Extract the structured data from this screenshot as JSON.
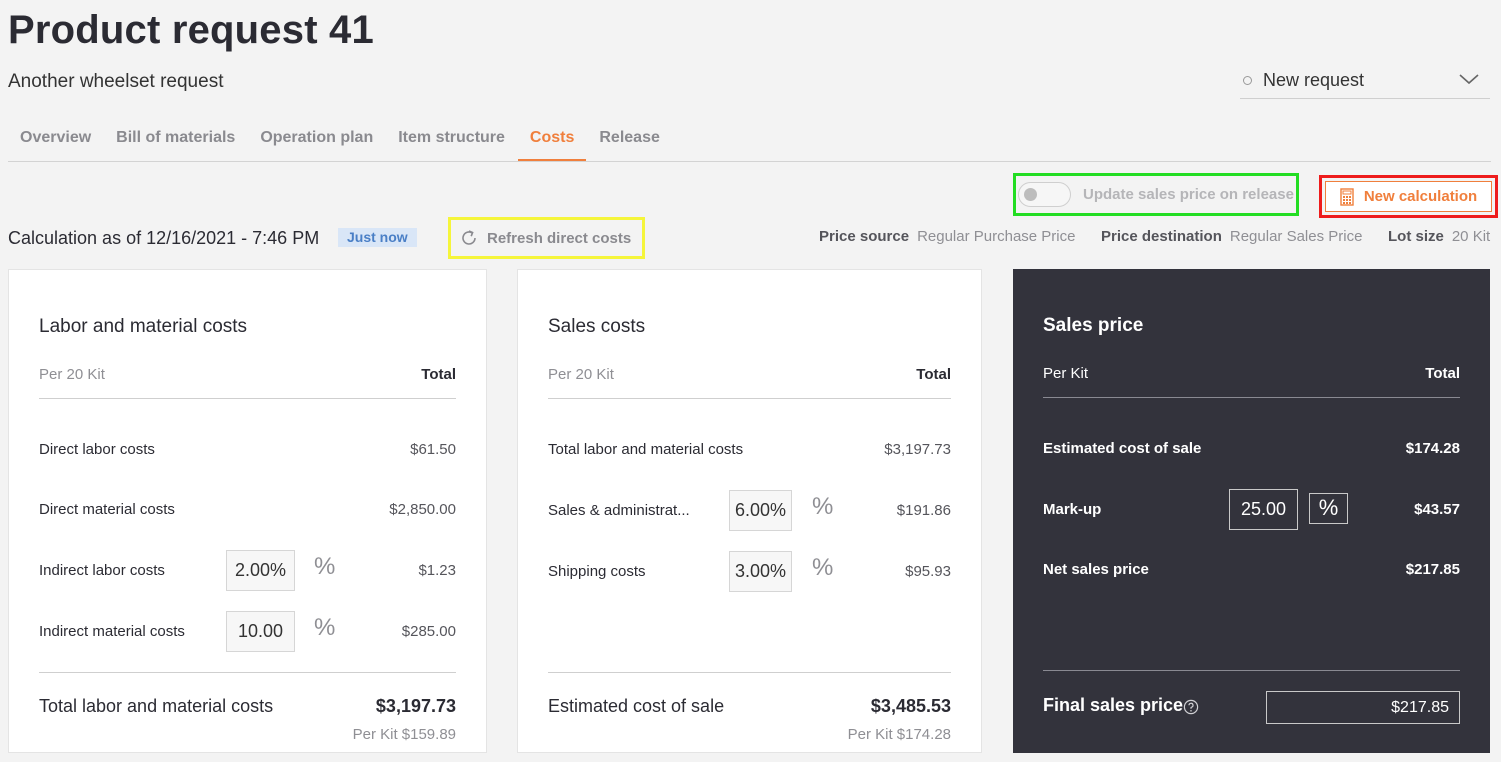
{
  "header": {
    "title": "Product request 41",
    "subtitle": "Another wheelset request",
    "status": "New request"
  },
  "tabs": [
    "Overview",
    "Bill of materials",
    "Operation plan",
    "Item structure",
    "Costs",
    "Release"
  ],
  "active_tab": "Costs",
  "toolbar": {
    "toggle_label": "Update sales price on release",
    "toggle_on": false,
    "new_calc_label": "New calculation",
    "calc_title": "Calculation as of 12/16/2021 - 7:46 PM",
    "badge": "Just now",
    "refresh_label": "Refresh direct costs"
  },
  "meta": {
    "price_source_label": "Price source",
    "price_source": "Regular Purchase Price",
    "price_dest_label": "Price destination",
    "price_dest": "Regular Sales Price",
    "lot_size_label": "Lot size",
    "lot_size": "20 Kit"
  },
  "labor": {
    "title": "Labor and material costs",
    "per": "Per 20 Kit",
    "total": "Total",
    "rows": [
      {
        "label": "Direct labor costs",
        "value": "$61.50"
      },
      {
        "label": "Direct material costs",
        "value": "$2,850.00"
      },
      {
        "label": "Indirect labor costs",
        "input": "2.00%",
        "value": "$1.23"
      },
      {
        "label": "Indirect material costs",
        "input": "10.00",
        "value": "$285.00"
      }
    ],
    "total_label": "Total labor and material costs",
    "total_value": "$3,197.73",
    "per_kit": "Per Kit $159.89"
  },
  "sales_costs": {
    "title": "Sales costs",
    "per": "Per 20 Kit",
    "total": "Total",
    "rows": [
      {
        "label": "Total labor and material costs",
        "value": "$3,197.73"
      },
      {
        "label": "Sales & administrat...",
        "input": "6.00%",
        "value": "$191.86"
      },
      {
        "label": "Shipping costs",
        "input": "3.00%",
        "value": "$95.93"
      }
    ],
    "total_label": "Estimated cost of sale",
    "total_value": "$3,485.53",
    "per_kit": "Per Kit $174.28"
  },
  "sales_price": {
    "title": "Sales price",
    "per": "Per Kit",
    "total": "Total",
    "rows": [
      {
        "label": "Estimated cost of sale",
        "value": "$174.28"
      },
      {
        "label": "Mark-up",
        "input": "25.00",
        "value": "$43.57"
      },
      {
        "label": "Net sales price",
        "value": "$217.85"
      }
    ],
    "final_label": "Final sales price",
    "final_value": "$217.85"
  },
  "percent_symbol": "%",
  "colors": {
    "accent": "#f07f3c",
    "dark_panel": "#33333c",
    "badge_bg": "#d9e6f7"
  }
}
